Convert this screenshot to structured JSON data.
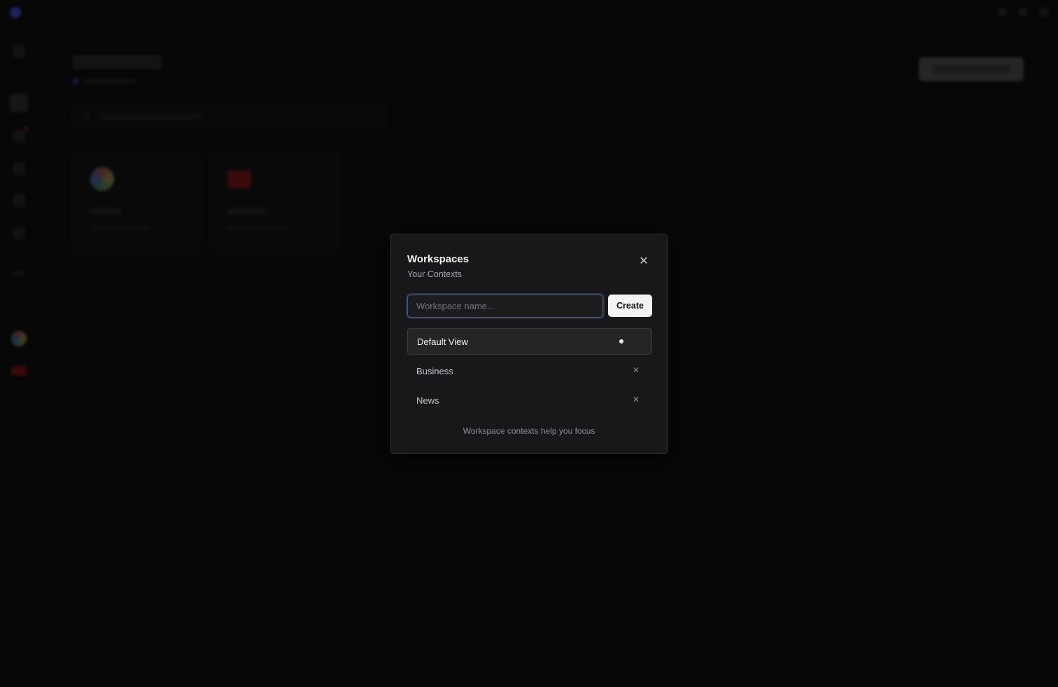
{
  "modal": {
    "title": "Workspaces",
    "subtitle": "Your Contexts",
    "input_placeholder": "Workspace name...",
    "input_value": "",
    "create_label": "Create",
    "close_icon": "close-icon",
    "workspaces": [
      {
        "name": "Default View",
        "active": true
      },
      {
        "name": "Business",
        "active": false
      },
      {
        "name": "News",
        "active": false
      }
    ],
    "footer": "Workspace contexts help you focus"
  },
  "colors": {
    "modal_bg": "#18181b",
    "modal_border": "#2c2c30",
    "input_focus_ring": "#4a5a8a",
    "create_button_bg": "#f4f4f5",
    "active_item_bg": "#252528",
    "page_bg": "#0b0b0c"
  }
}
